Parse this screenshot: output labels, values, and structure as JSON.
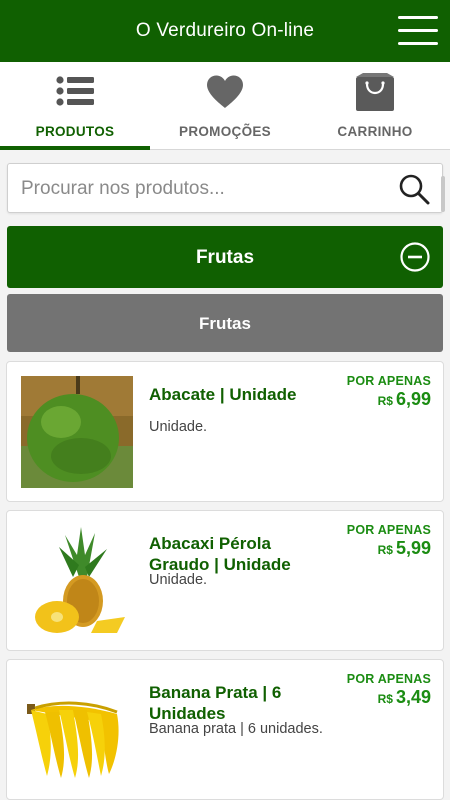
{
  "header": {
    "title": "O Verdureiro On-line",
    "menu_icon": "hamburger-menu-icon"
  },
  "tabs": [
    {
      "label": "PRODUTOS",
      "icon": "list-icon",
      "active": true
    },
    {
      "label": "PROMOÇÕES",
      "icon": "heart-icon",
      "active": false
    },
    {
      "label": "CARRINHO",
      "icon": "shopping-bag-icon",
      "active": false
    }
  ],
  "search": {
    "placeholder": "Procurar nos produtos...",
    "value": "",
    "icon": "search-icon"
  },
  "category": {
    "title": "Frutas",
    "icon": "collapse-minus-icon"
  },
  "subcategory": {
    "title": "Frutas"
  },
  "products": [
    {
      "name": "Abacate | Unidade",
      "description": "Unidade.",
      "price_label": "POR APENAS",
      "currency": "R$",
      "price": "6,99",
      "image": "avocado"
    },
    {
      "name": "Abacaxi Pérola Graudo | Unidade",
      "description": "Unidade.",
      "price_label": "POR APENAS",
      "currency": "R$",
      "price": "5,99",
      "image": "pineapple"
    },
    {
      "name": "Banana Prata | 6 Unidades",
      "description": "Banana prata | 6 unidades.",
      "price_label": "POR APENAS",
      "currency": "R$",
      "price": "3,49",
      "image": "bananas"
    }
  ],
  "colors": {
    "primary": "#106001",
    "price": "#1b8c12",
    "subcategory": "#737373",
    "tab_inactive": "#666666"
  }
}
